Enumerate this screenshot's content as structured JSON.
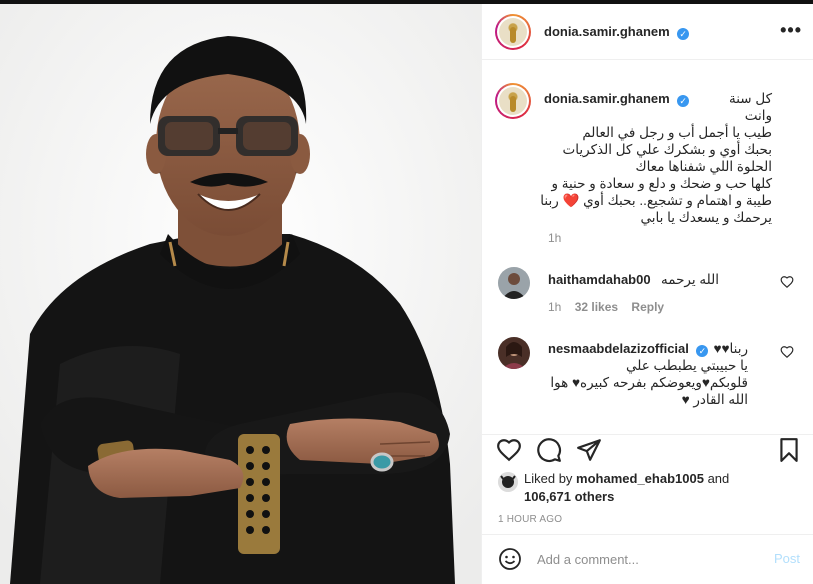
{
  "post": {
    "author": "donia.samir.ghanem",
    "verified": true
  },
  "caption": {
    "author": "donia.samir.ghanem",
    "lines": [
      "كل سنة وانت",
      "طيب يا أجمل أب و رجل في العالم",
      "بحبك أوي و بشكرك علي كل الذكريات",
      "الحلوة اللي شفناها معاك",
      "كلها حب و ضحك و دلع و سعادة و حنية و",
      "طيبة و اهتمام و تشجيع.. بحبك أوي ❤️ ربنا",
      "يرحمك و يسعدك يا بابي"
    ],
    "time": "1h"
  },
  "comments": [
    {
      "author": "haithamdahab00",
      "verified": false,
      "text": "الله يرحمه",
      "time": "1h",
      "likes": "32 likes",
      "reply": "Reply"
    },
    {
      "author": "nesmaabdelazizofficial",
      "verified": true,
      "lines": [
        "ربنا♥♥",
        "يا حبيبتي يطبطب علي",
        "قلوبكم♥ويعوضكم بفرحه كبيره♥ هوا",
        "الله القادر ♥"
      ]
    }
  ],
  "likes": {
    "prefix": "Liked by",
    "user": "mohamed_ehab1005",
    "and": "and",
    "count": "106,671 others"
  },
  "timestamp": "1 HOUR AGO",
  "add_comment": {
    "placeholder": "Add a comment...",
    "post_label": "Post"
  },
  "icons": {
    "like": "heart-icon",
    "comment": "comment-icon",
    "share": "paper-plane-icon",
    "save": "bookmark-icon",
    "emoji": "smiley-icon",
    "more": "more-options-icon"
  },
  "colors": {
    "verified": "#3897f0",
    "post_button": "#b2dffc",
    "heart": "#ed4956",
    "secondary_text": "#8e8e8e"
  }
}
